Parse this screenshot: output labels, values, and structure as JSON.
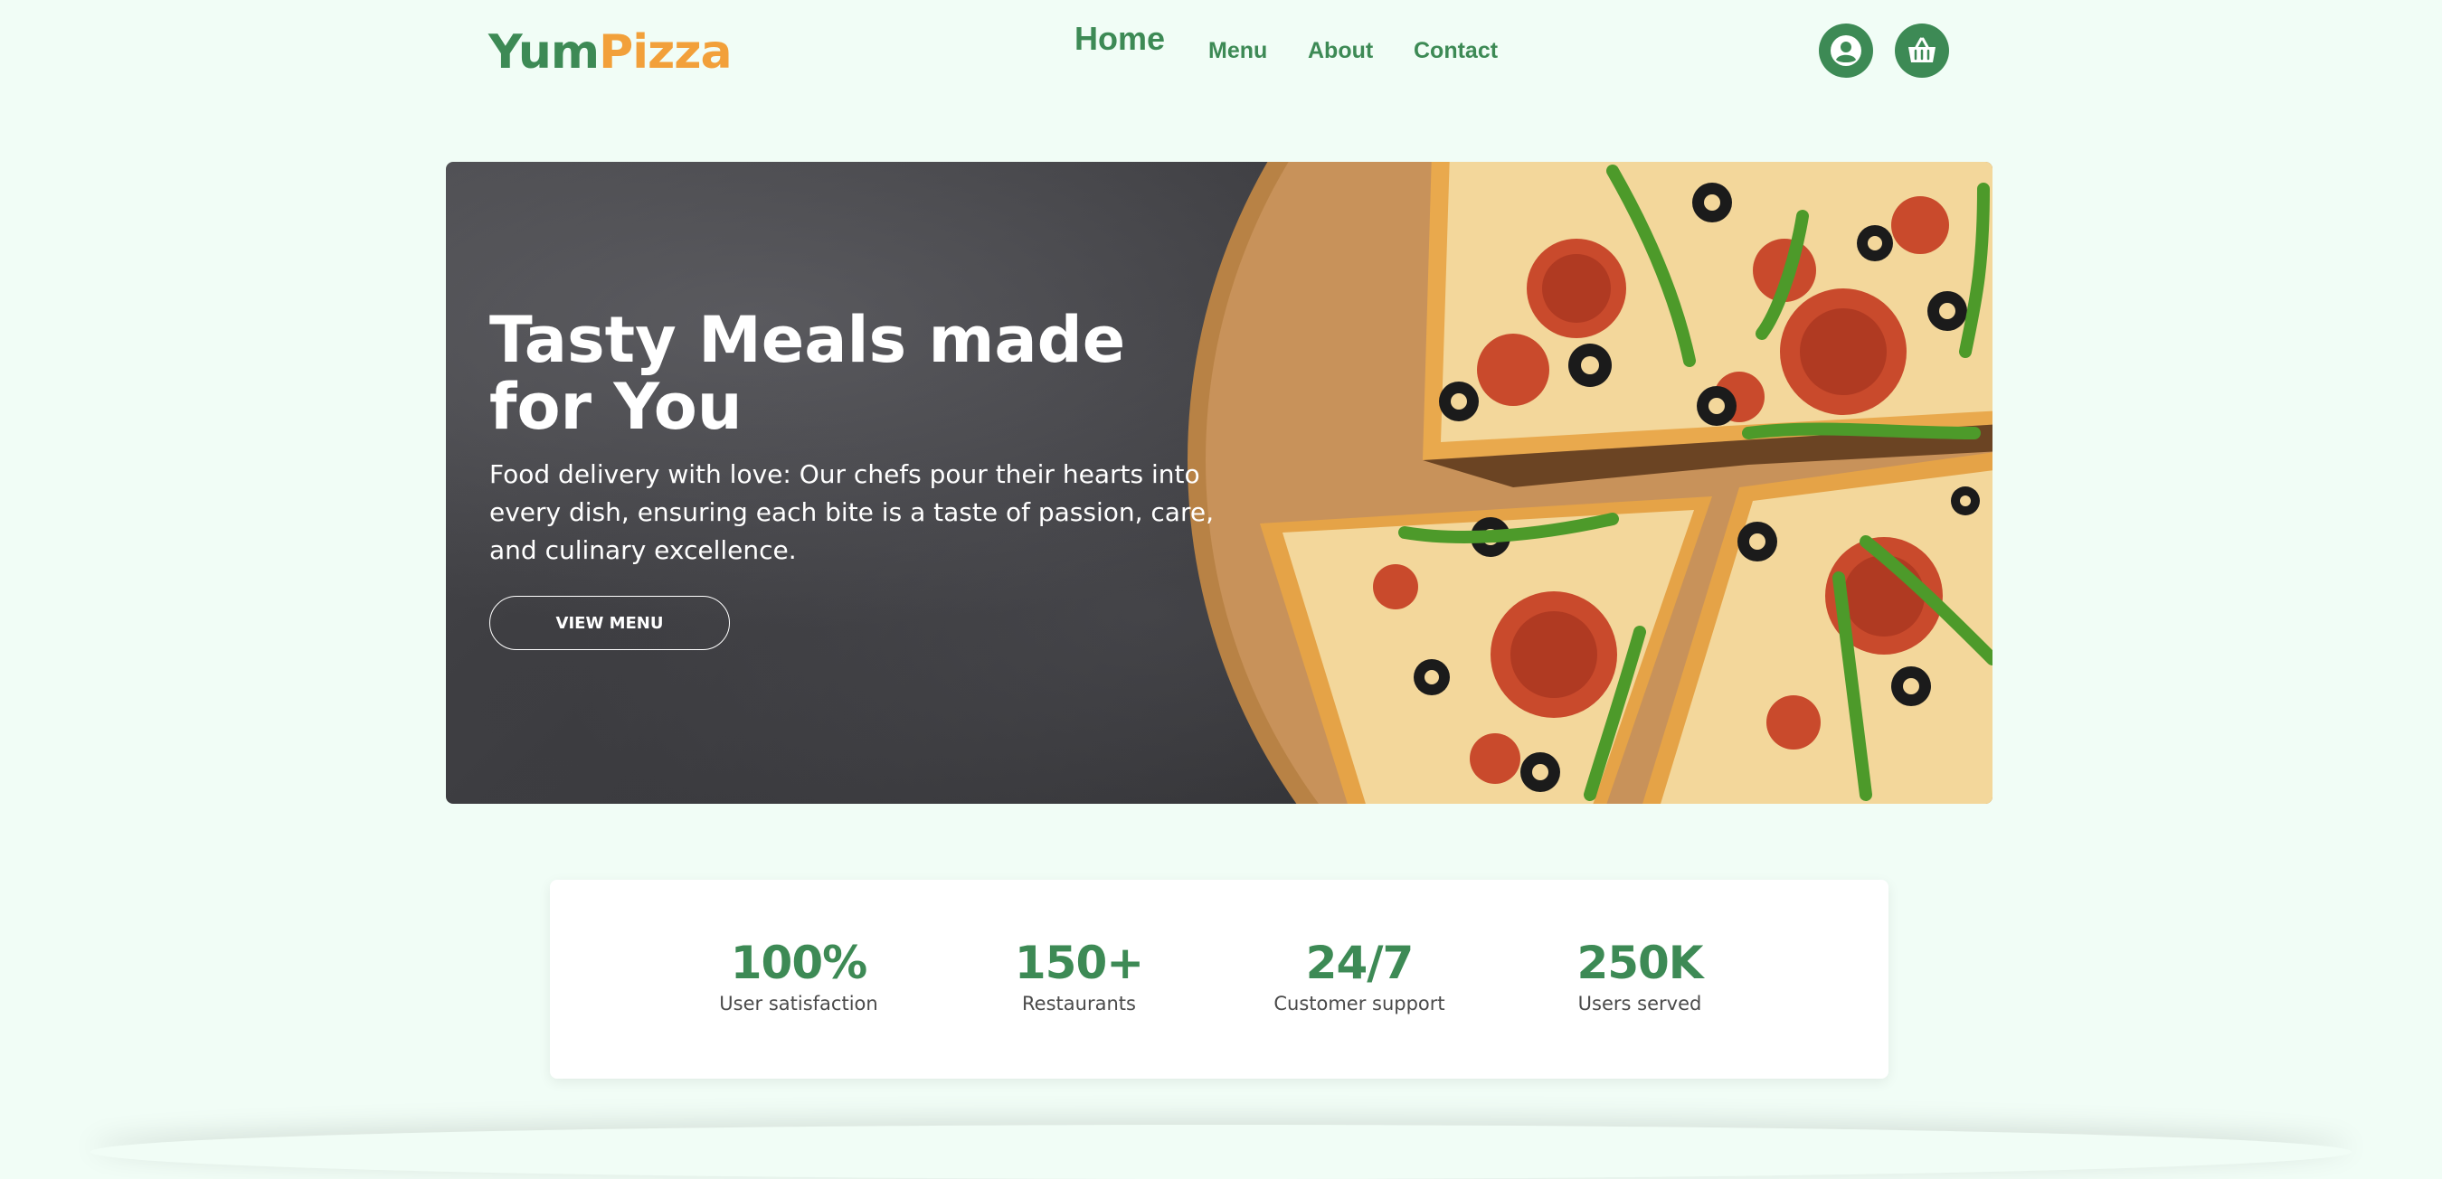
{
  "brand": {
    "name_part1": "Yum",
    "name_part2": "Pizza",
    "color_primary": "#3d8a55",
    "color_accent": "#f2a03a",
    "background": "#f1fdf6"
  },
  "nav": {
    "items": [
      {
        "label": "Home",
        "active": true
      },
      {
        "label": "Menu"
      },
      {
        "label": "About"
      },
      {
        "label": "Contact"
      }
    ],
    "icons": [
      "user-circle-icon",
      "basket-icon"
    ]
  },
  "hero": {
    "title": "Tasty Meals made for You",
    "description": "Food delivery with love: Our chefs pour their hearts into every dish, ensuring each bite is a taste of passion, care, and culinary excellence.",
    "button_label": "VIEW MENU",
    "image": "pizza-image"
  },
  "stats": [
    {
      "value": "100%",
      "label": "User satisfaction"
    },
    {
      "value": "150+",
      "label": "Restaurants"
    },
    {
      "value": "24/7",
      "label": "Customer support"
    },
    {
      "value": "250K",
      "label": "Users served"
    }
  ]
}
